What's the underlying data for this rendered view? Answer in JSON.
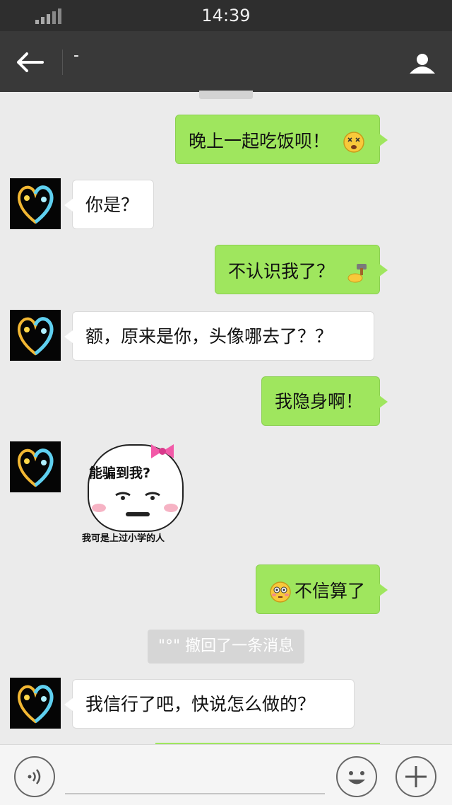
{
  "status_bar": {
    "time": "14:39",
    "signal_icon": "signal-icon"
  },
  "nav": {
    "title": "-",
    "back_icon": "back-arrow-icon",
    "profile_icon": "profile-icon"
  },
  "messages": [
    {
      "side": "right",
      "text": "晚上一起吃饭呗！",
      "emoji": "dizzy-face-emoji"
    },
    {
      "side": "left",
      "text": "你是？"
    },
    {
      "side": "right",
      "text": "不认识我了？",
      "emoji": "hammer-emoji"
    },
    {
      "side": "left",
      "text": "额，原来是你，头像哪去了？？"
    },
    {
      "side": "right",
      "text": "我隐身啊！"
    },
    {
      "side": "left",
      "type": "sticker",
      "caption": "能骗到我?",
      "subcaption": "我可是上过小学的人"
    },
    {
      "side": "right",
      "text": "不信算了",
      "emoji": "flushed-face-emoji"
    },
    {
      "side": "left",
      "text": "我信行了吧，快说怎么做的？"
    }
  ],
  "recall_notice": "\"°\" 撤回了一条消息",
  "input_bar": {
    "voice_icon": "voice-icon",
    "emoji_icon": "smiley-icon",
    "more_icon": "plus-icon",
    "placeholder": ""
  },
  "colors": {
    "outgoing_bubble": "#9fe65e",
    "incoming_bubble": "#ffffff",
    "nav_bar": "#393939",
    "background": "#ebebeb"
  }
}
